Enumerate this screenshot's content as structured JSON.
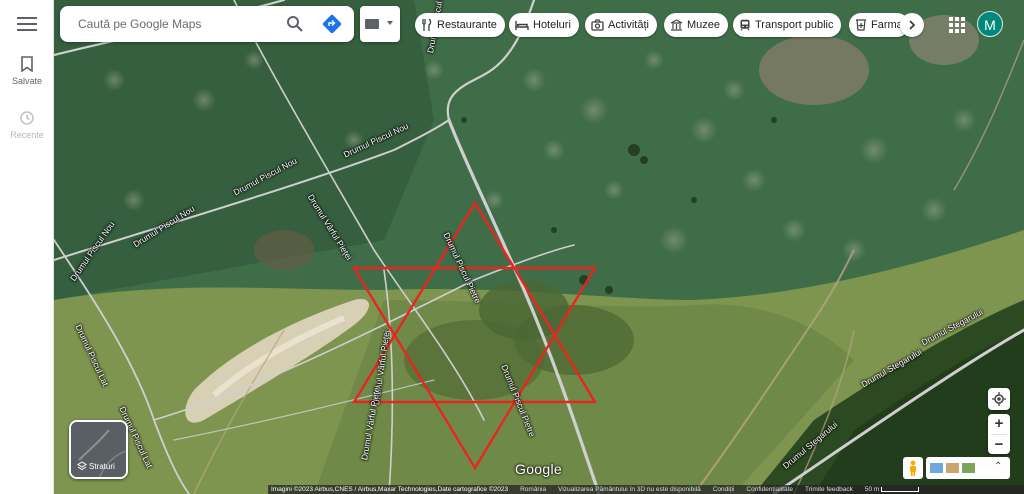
{
  "search": {
    "placeholder": "Caută pe Google Maps"
  },
  "rail": {
    "items": [
      {
        "label": "Salvate",
        "icon": "bookmark-icon",
        "enabled": true
      },
      {
        "label": "Recente",
        "icon": "history-icon",
        "enabled": false
      }
    ]
  },
  "chips": [
    {
      "label": "Restaurante",
      "icon": "restaurant-icon"
    },
    {
      "label": "Hoteluri",
      "icon": "hotel-icon"
    },
    {
      "label": "Activități",
      "icon": "camera-icon"
    },
    {
      "label": "Muzee",
      "icon": "museum-icon"
    },
    {
      "label": "Transport public",
      "icon": "transit-icon"
    },
    {
      "label": "Farmacii",
      "icon": "pharmacy-icon"
    }
  ],
  "account": {
    "initial": "M",
    "color": "#00897b"
  },
  "map": {
    "layers_label": "Straturi",
    "logo": "Google",
    "street_labels": [
      "Drumul Piscul Mare",
      "Drumul Piscul Nou",
      "Drumul Piscul Nou",
      "Drumul Piscul Nou",
      "Drumul Piscul Nou",
      "Drumul Vârful Pieței",
      "Drumul Piscul Pietre",
      "Drumul Vârful Pieței",
      "Drumul Piscul Pietre",
      "Drumul Piscul Lat",
      "Drumul Piscul Lat",
      "Drumul Stegarului",
      "Drumul Stegarului",
      "Drumul Stegarului",
      "Drumul Vârful Pieței"
    ],
    "star_color": "#e8261f"
  },
  "footer": {
    "attribution": "Imagini ©2023 Airbus,CNES / Airbus,Maxar Technologies,Date cartografice ©2023",
    "links": [
      "România",
      "Vizualizarea Pământului în 3D nu este disponibilă",
      "Condiții",
      "Confidențialitate",
      "Trimite feedback"
    ],
    "scale": "50 m"
  }
}
